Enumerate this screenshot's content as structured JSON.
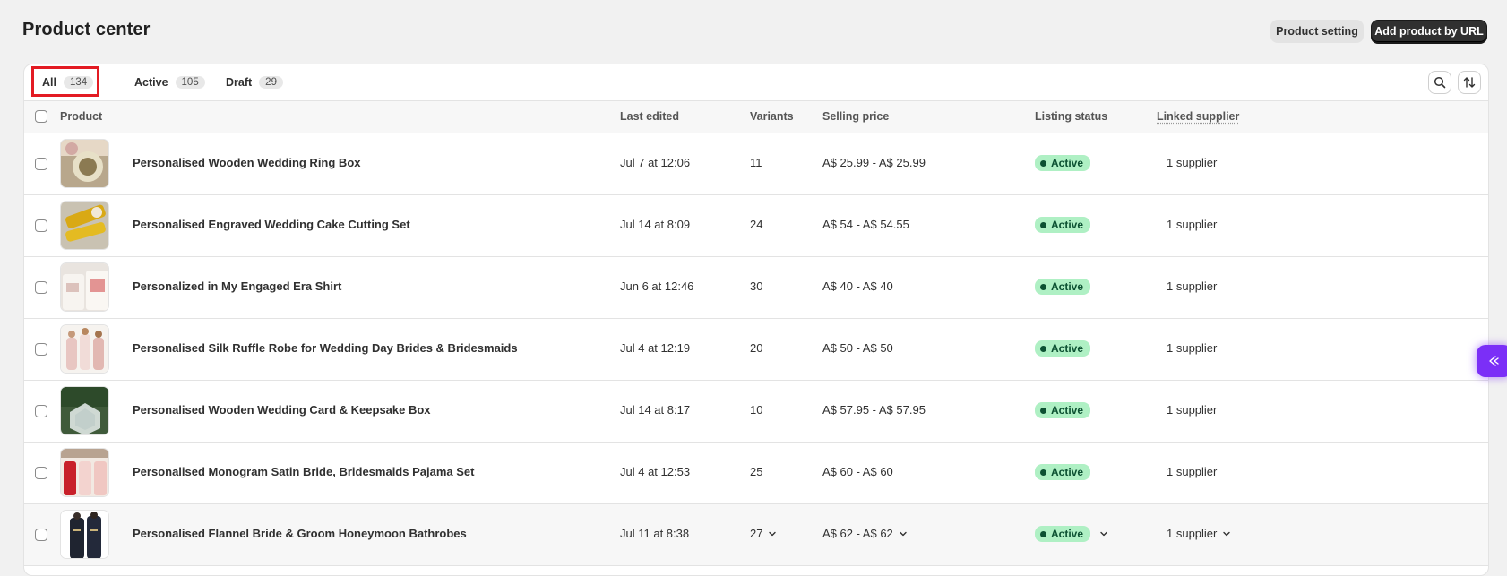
{
  "page": {
    "title": "Product center",
    "product_setting_label": "Product setting",
    "add_by_url_label": "Add product by URL"
  },
  "tabs": [
    {
      "label": "All",
      "count": "134"
    },
    {
      "label": "Active",
      "count": "105"
    },
    {
      "label": "Draft",
      "count": "29"
    }
  ],
  "table": {
    "headers": {
      "product": "Product",
      "last_edited": "Last edited",
      "variants": "Variants",
      "selling_price": "Selling price",
      "listing_status": "Listing status",
      "linked_supplier": "Linked supplier"
    },
    "rows": [
      {
        "name": "Personalised Wooden Wedding Ring Box",
        "edited": "Jul 7 at 12:06",
        "variants": "11",
        "price": "A$ 25.99 - A$ 25.99",
        "status": "Active",
        "supplier": "1 supplier"
      },
      {
        "name": "Personalised Engraved Wedding Cake Cutting Set",
        "edited": "Jul 14 at 8:09",
        "variants": "24",
        "price": "A$ 54 - A$ 54.55",
        "status": "Active",
        "supplier": "1 supplier"
      },
      {
        "name": "Personalized in My Engaged Era Shirt",
        "edited": "Jun 6 at 12:46",
        "variants": "30",
        "price": "A$ 40 - A$ 40",
        "status": "Active",
        "supplier": "1 supplier"
      },
      {
        "name": "Personalised Silk Ruffle Robe for Wedding Day Brides & Bridesmaids",
        "edited": "Jul 4 at 12:19",
        "variants": "20",
        "price": "A$ 50 - A$ 50",
        "status": "Active",
        "supplier": "1 supplier"
      },
      {
        "name": "Personalised Wooden Wedding Card & Keepsake Box",
        "edited": "Jul 14 at 8:17",
        "variants": "10",
        "price": "A$ 57.95 - A$ 57.95",
        "status": "Active",
        "supplier": "1 supplier"
      },
      {
        "name": "Personalised Monogram Satin Bride, Bridesmaids Pajama Set",
        "edited": "Jul 4 at 12:53",
        "variants": "25",
        "price": "A$ 60 - A$ 60",
        "status": "Active",
        "supplier": "1 supplier"
      },
      {
        "name": "Personalised Flannel Bride & Groom Honeymoon Bathrobes",
        "edited": "Jul 11 at 8:38",
        "variants": "27",
        "price": "A$ 62 - A$ 62",
        "status": "Active",
        "supplier": "1 supplier"
      }
    ]
  },
  "colors": {
    "accent_primary": "#303030",
    "status_active_bg": "#aff0c4",
    "status_active_fg": "#0c5132",
    "highlight": "#e31b23",
    "widget": "#7b2ff7"
  },
  "icons": [
    "search-icon",
    "sort-icon",
    "chevron-down-icon",
    "assistant-icon"
  ]
}
